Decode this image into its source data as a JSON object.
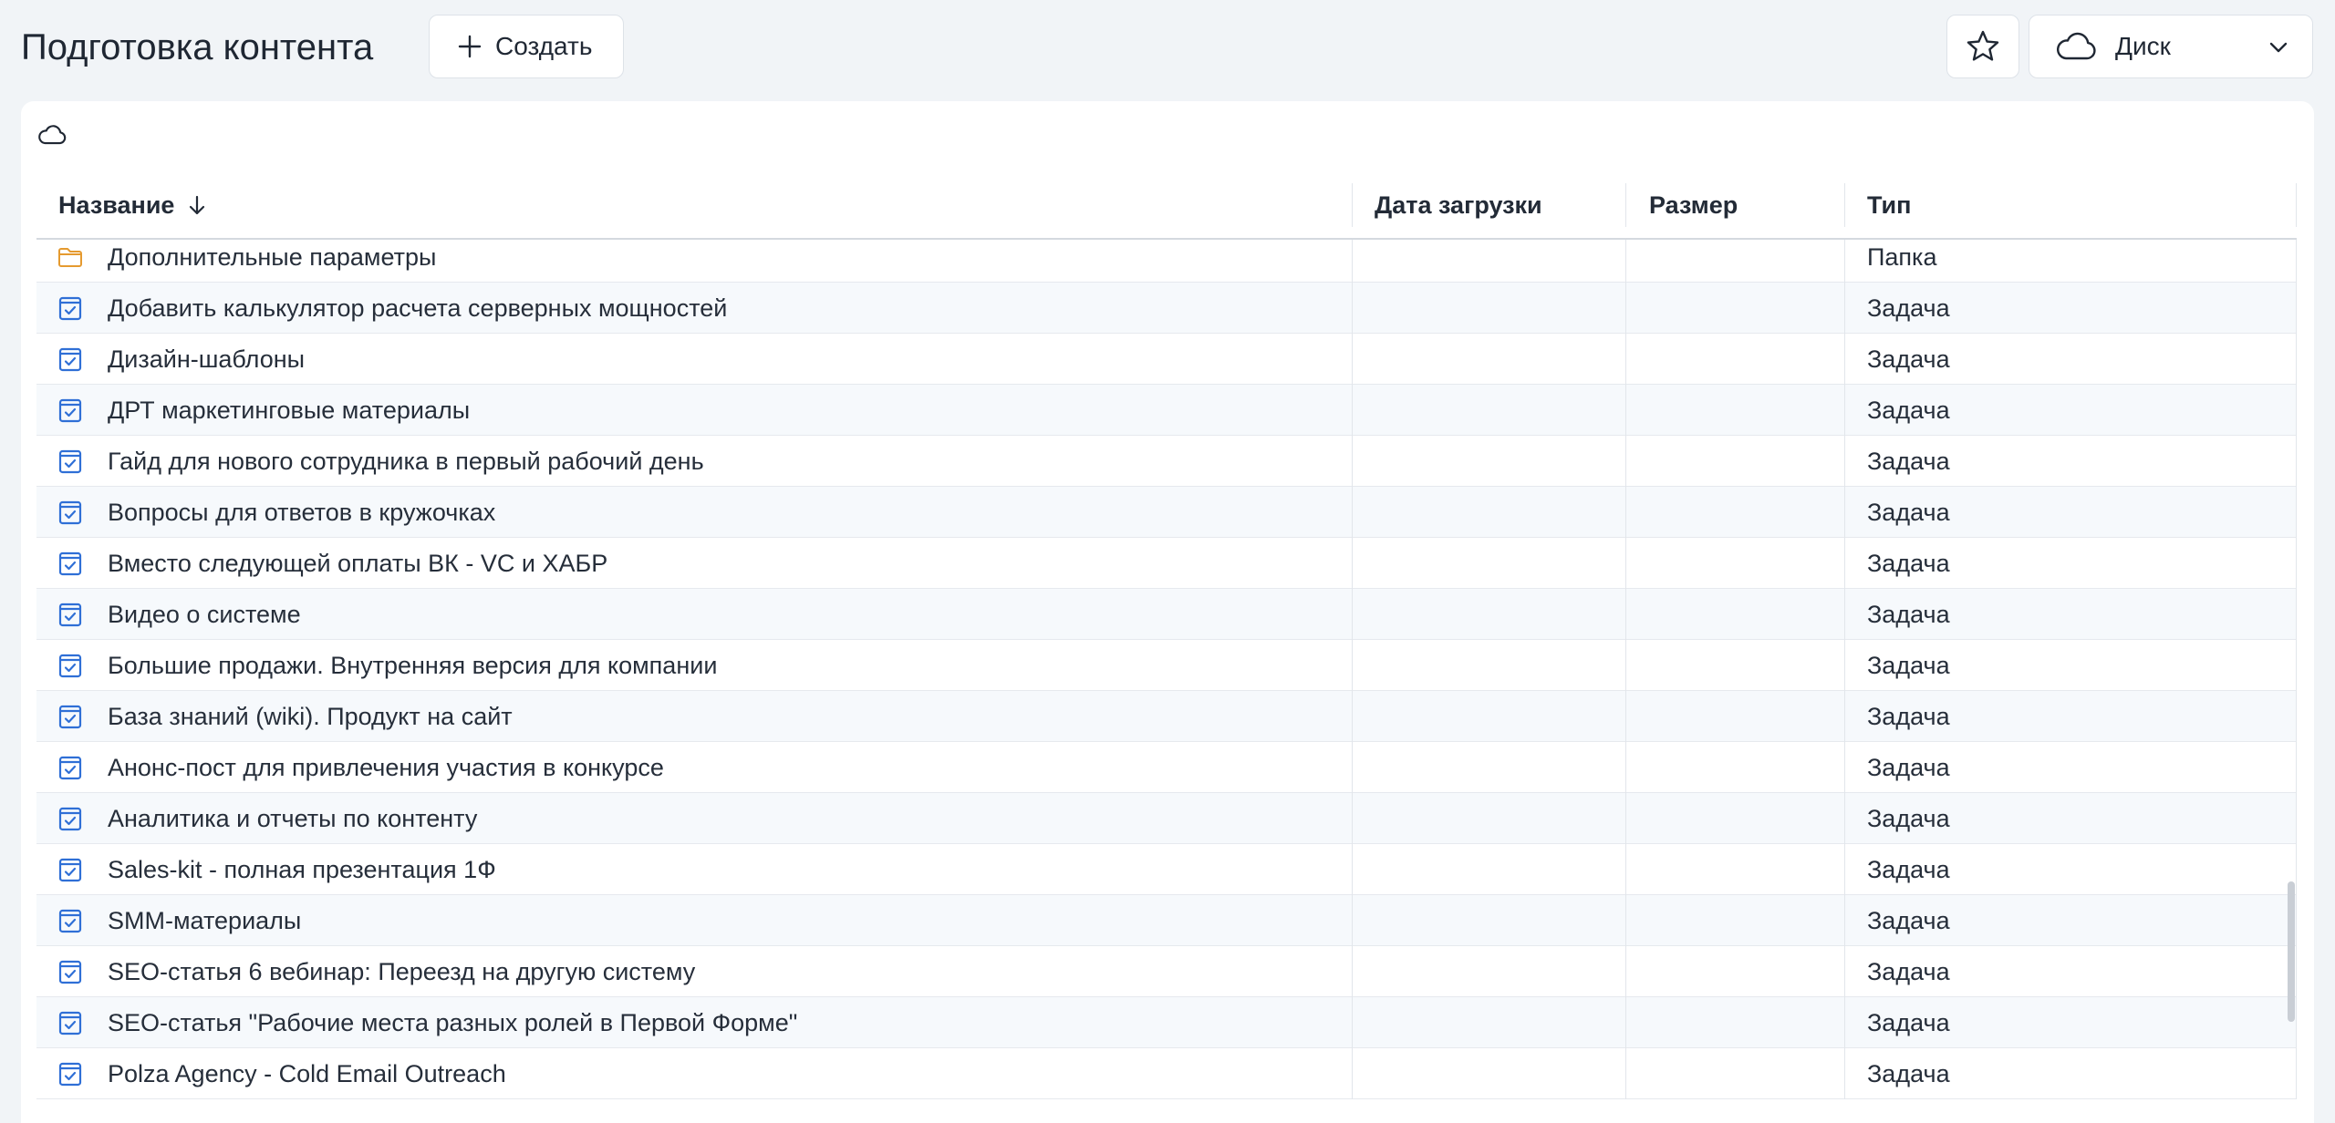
{
  "header": {
    "title": "Подготовка контента",
    "create_label": "Создать",
    "favorite_icon": "star-icon",
    "storage_select": {
      "selected": "Диск",
      "icon": "cloud-icon"
    }
  },
  "table": {
    "columns": {
      "name": "Название",
      "sort_icon": "arrow-down-icon",
      "date": "Дата загрузки",
      "size": "Размер",
      "type": "Тип"
    },
    "rows": [
      {
        "icon": "folder-icon",
        "name": "Дополнительные параметры",
        "date": "",
        "size": "",
        "type": "Папка"
      },
      {
        "icon": "task-icon",
        "name": "Добавить калькулятор расчета серверных мощностей",
        "date": "",
        "size": "",
        "type": "Задача"
      },
      {
        "icon": "task-icon",
        "name": "Дизайн-шаблоны",
        "date": "",
        "size": "",
        "type": "Задача"
      },
      {
        "icon": "task-icon",
        "name": "ДРТ маркетинговые материалы",
        "date": "",
        "size": "",
        "type": "Задача"
      },
      {
        "icon": "task-icon",
        "name": "Гайд для нового сотрудника в первый рабочий день",
        "date": "",
        "size": "",
        "type": "Задача"
      },
      {
        "icon": "task-icon",
        "name": "Вопросы для ответов в кружочках",
        "date": "",
        "size": "",
        "type": "Задача"
      },
      {
        "icon": "task-icon",
        "name": "Вместо следующей оплаты ВК - VC и ХАБР",
        "date": "",
        "size": "",
        "type": "Задача"
      },
      {
        "icon": "task-icon",
        "name": "Видео о системе",
        "date": "",
        "size": "",
        "type": "Задача"
      },
      {
        "icon": "task-icon",
        "name": "Большие продажи. Внутренняя версия для компании",
        "date": "",
        "size": "",
        "type": "Задача"
      },
      {
        "icon": "task-icon",
        "name": "База знаний (wiki). Продукт на сайт",
        "date": "",
        "size": "",
        "type": "Задача"
      },
      {
        "icon": "task-icon",
        "name": "Анонс-пост для привлечения участия в конкурсе",
        "date": "",
        "size": "",
        "type": "Задача"
      },
      {
        "icon": "task-icon",
        "name": "Аналитика и отчеты по контенту",
        "date": "",
        "size": "",
        "type": "Задача"
      },
      {
        "icon": "task-icon",
        "name": "Sales-kit - полная презентация 1Ф",
        "date": "",
        "size": "",
        "type": "Задача"
      },
      {
        "icon": "task-icon",
        "name": "SMM-материалы",
        "date": "",
        "size": "",
        "type": "Задача"
      },
      {
        "icon": "task-icon",
        "name": "SEO-статья 6 вебинар: Переезд на другую систему",
        "date": "",
        "size": "",
        "type": "Задача"
      },
      {
        "icon": "task-icon",
        "name": "SEO-статья \"Рабочие места разных ролей в Первой Форме\"",
        "date": "",
        "size": "",
        "type": "Задача"
      },
      {
        "icon": "task-icon",
        "name": "Polza Agency - Cold Email Outreach",
        "date": "",
        "size": "",
        "type": "Задача"
      }
    ]
  },
  "colors": {
    "folder": "#e59a2f",
    "task": "#2f6fd6",
    "page_bg": "#f1f4f7"
  }
}
